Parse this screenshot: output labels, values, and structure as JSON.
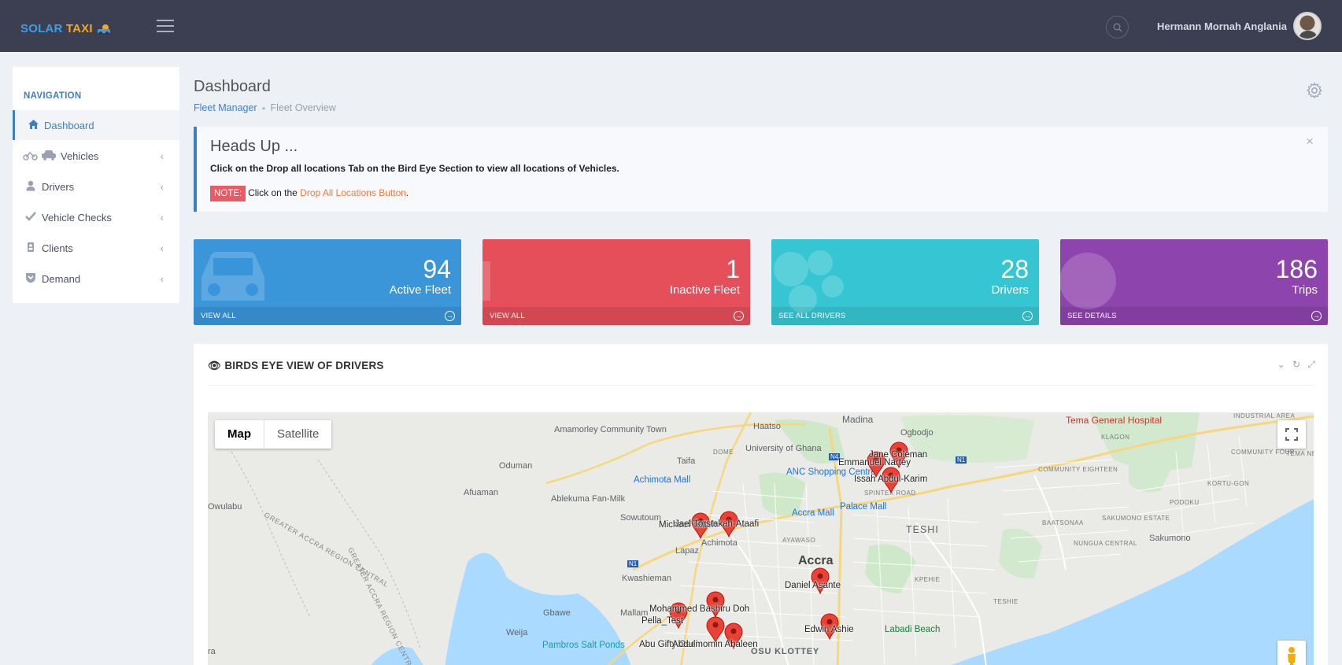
{
  "app": {
    "logo_part1": "SOLAR ",
    "logo_part2": "TAXI"
  },
  "topbar": {
    "username": "Hermann Mornah Anglania"
  },
  "sidebar": {
    "title": "NAVIGATION",
    "items": [
      {
        "label": "Dashboard",
        "icon": "home-icon",
        "active": true
      },
      {
        "label": "Vehicles",
        "icon": "vehicles-icon"
      },
      {
        "label": "Drivers",
        "icon": "user-icon"
      },
      {
        "label": "Vehicle Checks",
        "icon": "check-icon"
      },
      {
        "label": "Clients",
        "icon": "client-icon"
      },
      {
        "label": "Demand",
        "icon": "shield-icon"
      }
    ]
  },
  "header": {
    "title": "Dashboard",
    "breadcrumb": [
      "Fleet Manager",
      "Fleet Overview"
    ]
  },
  "alert": {
    "title": "Heads Up ...",
    "message": "Click on the Drop all locations Tab on the Bird Eye Section to view all locations of Vehicles.",
    "note_badge": "NOTE:",
    "note_text": "Click on the ",
    "note_link": "Drop All Locations Button",
    "note_end": "."
  },
  "stats": [
    {
      "value": "94",
      "label": "Active Fleet",
      "link": "VIEW ALL",
      "color": "#3a95d9"
    },
    {
      "value": "1",
      "label": "Inactive Fleet",
      "link": "VIEW ALL",
      "color": "#e44f5a"
    },
    {
      "value": "28",
      "label": "Drivers",
      "link": "SEE ALL DRIVERS",
      "color": "#36c6d3"
    },
    {
      "value": "186",
      "label": "Trips",
      "link": "SEE DETAILS",
      "color": "#8e44ad"
    }
  ],
  "panel": {
    "title": "BIRDS EYE VIEW OF DRIVERS"
  },
  "map": {
    "type_map": "Map",
    "type_satellite": "Satellite",
    "places": {
      "amamorley": "Amamorley Community Town",
      "haatso": "Haatso",
      "madina": "Madina",
      "ogbodjo": "Ogbodjo",
      "tema_hospital": "Tema General Hospital",
      "industrial": "INDUSTRIAL AREA",
      "klagon": "KLAGON",
      "community_four": "COMMUNITY FOUR",
      "tema_new_town": "TEMA NEW TOWN",
      "dome": "DOME",
      "oduman": "Oduman",
      "taifa": "Taifa",
      "univ": "University of Ghana",
      "anc": "ANC Shopping Centre",
      "achimota_mall": "Achimota Mall",
      "afuaman": "Afuaman",
      "ablekuma": "Ablekuma Fan-Milk",
      "owulabu": "Owulabu",
      "spintex": "SPINTEX ROAD",
      "community_eighteen": "COMMUNITY EIGHTEEN",
      "kortu_gon": "KORTU-GON",
      "podoku": "PODOKU",
      "palace_mall": "Palace Mall",
      "accra_mall": "Accra Mall",
      "sowutoum": "Sowutoum",
      "ayawaso": "AYAWASO",
      "teshi": "TESHI",
      "baatsonaa": "BAATSONAA",
      "sakumono_estate": "SAKUMONO ESTATE",
      "sakumono": "Sakumono",
      "nungua": "NUNGUA CENTRAL",
      "lapaz": "Lapaz",
      "achimota": "Achimota",
      "accra": "Accra",
      "region1": "GREATER ACCRA REGION CENTRAL",
      "region2": "GREATER ACCRA REGION CENTRAL",
      "kwashieman": "Kwashieman",
      "kpehie": "KPEHIE",
      "teshie": "TESHIE",
      "gbawe": "Gbawe",
      "mallam": "Mallam",
      "weija": "Weija",
      "pambros": "Pambros Salt Ponds",
      "labadi": "Labadi Beach",
      "osu": "OSU KLOTTEY",
      "rd_n4": "N4",
      "rd_n1a": "N1",
      "rd_n1b": "N1",
      "edge_ra": "ra"
    },
    "markers": [
      "Jane Coleman",
      "Emmanuel Nartey",
      "Issah Abdul-Karim",
      "Michael Tetteh",
      "Jael Torstakah-Ataafi",
      "Daniel Asante",
      "Mohammed Bashiru Doh",
      "Pella_Test",
      "Edwin Ashie",
      "Abu Gifty Osei",
      "Abdulmomin Abaleen"
    ]
  }
}
